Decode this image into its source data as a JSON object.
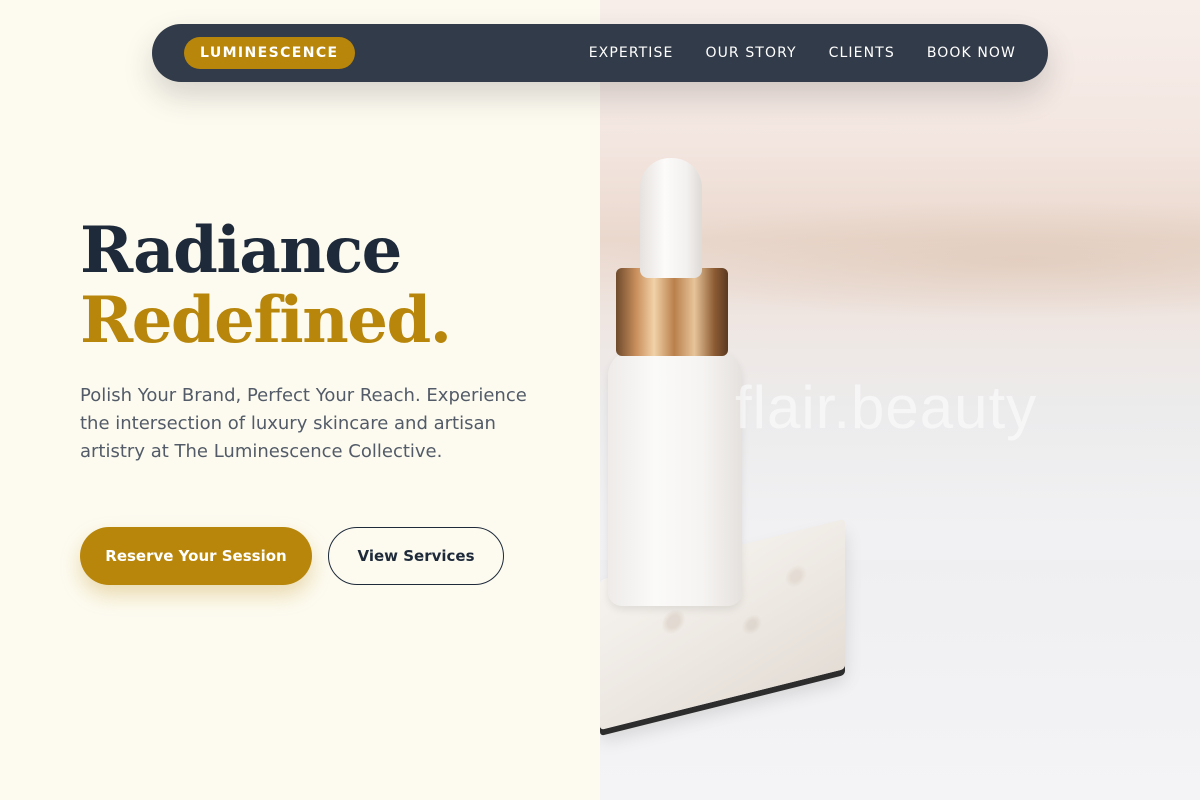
{
  "nav": {
    "brand": "LUMINESCENCE",
    "links": [
      "EXPERTISE",
      "OUR STORY",
      "CLIENTS",
      "BOOK NOW"
    ]
  },
  "hero": {
    "headline_line1": "Radiance",
    "headline_line2": "Redefined.",
    "lede": "Polish Your Brand, Perfect Your Reach. Experience the intersection of luxury skincare and artisan artistry at The Luminescence Collective.",
    "primary_cta": "Reserve Your Session",
    "secondary_cta": "View Services"
  },
  "photo": {
    "watermark": "flair.beauty"
  },
  "colors": {
    "accent_gold": "#b8860b",
    "navy": "#1e2a3a",
    "nav_bg": "#323b49",
    "page_bg": "#fdfbf0"
  }
}
